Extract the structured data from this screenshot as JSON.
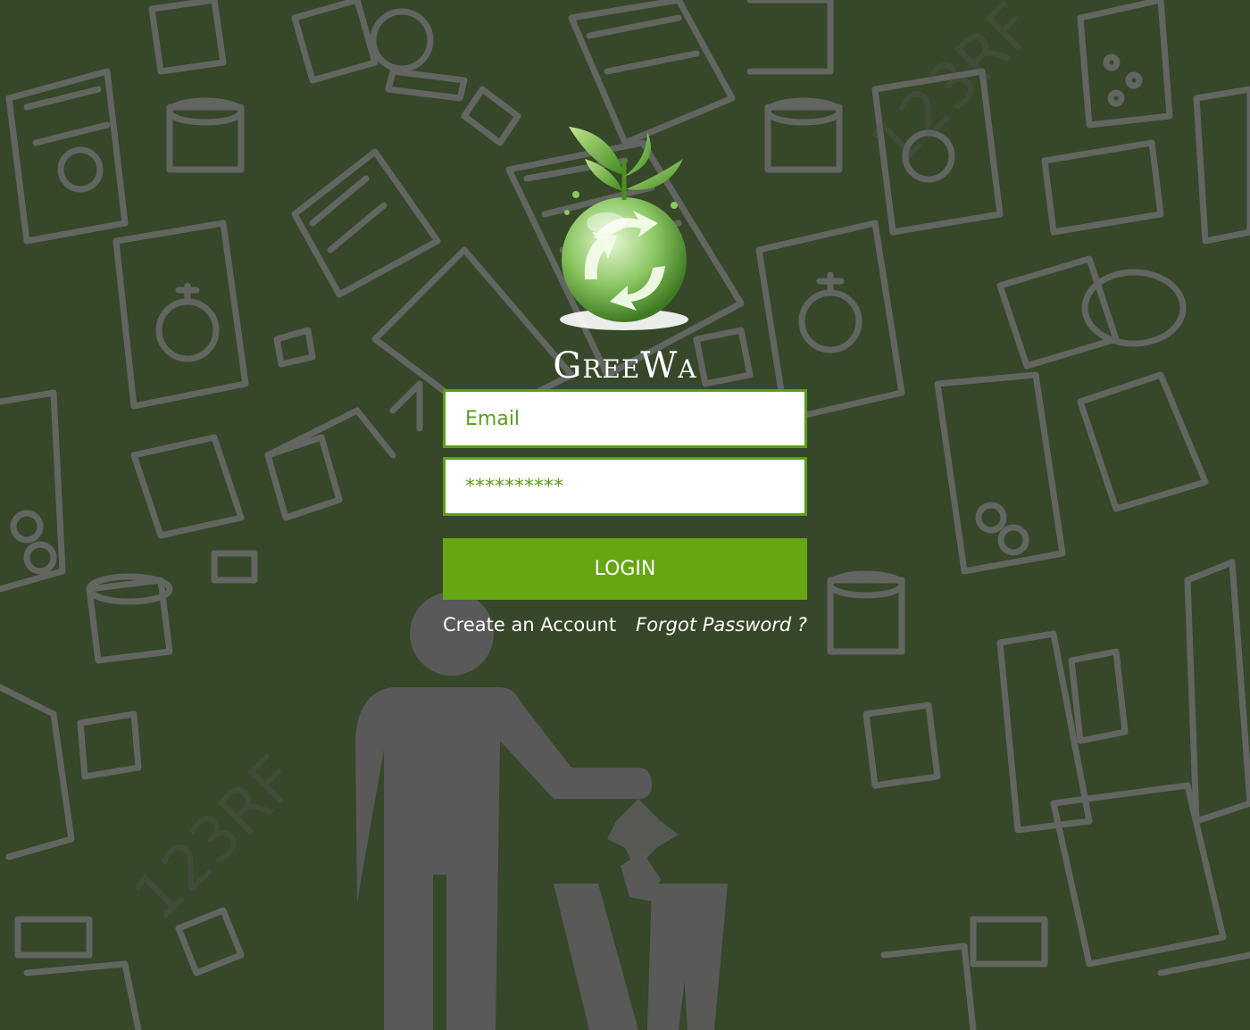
{
  "app": {
    "brand_name": "GreeWa"
  },
  "login": {
    "email_placeholder": "Email",
    "password_value": "**********",
    "login_label": "LOGIN",
    "create_account_label": "Create an Account",
    "forgot_password_label": "Forgot Password ?"
  },
  "colors": {
    "background": "#36472a",
    "accent": "#65a612",
    "field_border": "#5a9e18",
    "doodle": "#6b6b6b"
  },
  "icons": {
    "logo": "recycle-globe-sprout-icon",
    "background": "trash-doodle-pattern"
  }
}
